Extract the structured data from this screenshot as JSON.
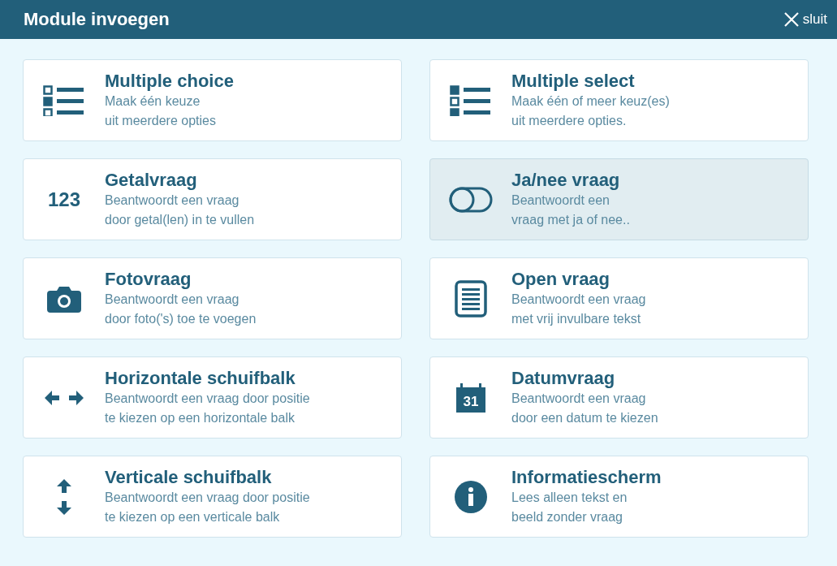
{
  "window": {
    "title": "Module invoegen",
    "close_label": "sluit"
  },
  "modules": [
    {
      "kind": "choice",
      "title": "Multiple choice",
      "lines": [
        "Maak één keuze",
        "uit meerdere opties"
      ],
      "selected": false
    },
    {
      "kind": "select",
      "title": "Multiple select",
      "lines": [
        "Maak één of meer keuz(es)",
        "uit meerdere opties."
      ],
      "selected": false
    },
    {
      "kind": "number",
      "icon_text": "123",
      "title": "Getalvraag",
      "lines": [
        "Beantwoordt een vraag",
        "door getal(len) in te vullen"
      ],
      "selected": false
    },
    {
      "kind": "toggle",
      "title": "Ja/nee vraag",
      "lines": [
        "Beantwoordt een",
        "vraag met ja of nee.."
      ],
      "selected": true
    },
    {
      "kind": "camera",
      "title": "Fotovraag",
      "lines": [
        "Beantwoordt een vraag",
        "door foto('s) toe te voegen"
      ],
      "selected": false
    },
    {
      "kind": "document",
      "title": "Open vraag",
      "lines": [
        "Beantwoordt een vraag",
        "met vrij invulbare tekst"
      ],
      "selected": false
    },
    {
      "kind": "hslider",
      "title": "Horizontale schuifbalk",
      "lines": [
        "Beantwoordt een vraag door positie",
        "te kiezen op een horizontale balk"
      ],
      "selected": false
    },
    {
      "kind": "calendar",
      "icon_text": "31",
      "title": "Datumvraag",
      "lines": [
        "Beantwoordt een vraag",
        "door een datum te kiezen"
      ],
      "selected": false
    },
    {
      "kind": "vslider",
      "title": "Verticale schuifbalk",
      "lines": [
        "Beantwoordt een vraag door positie",
        "te kiezen op een verticale balk"
      ],
      "selected": false
    },
    {
      "kind": "info",
      "title": "Informatiescherm",
      "lines": [
        "Lees alleen tekst en",
        "beeld zonder vraag"
      ],
      "selected": false
    }
  ]
}
